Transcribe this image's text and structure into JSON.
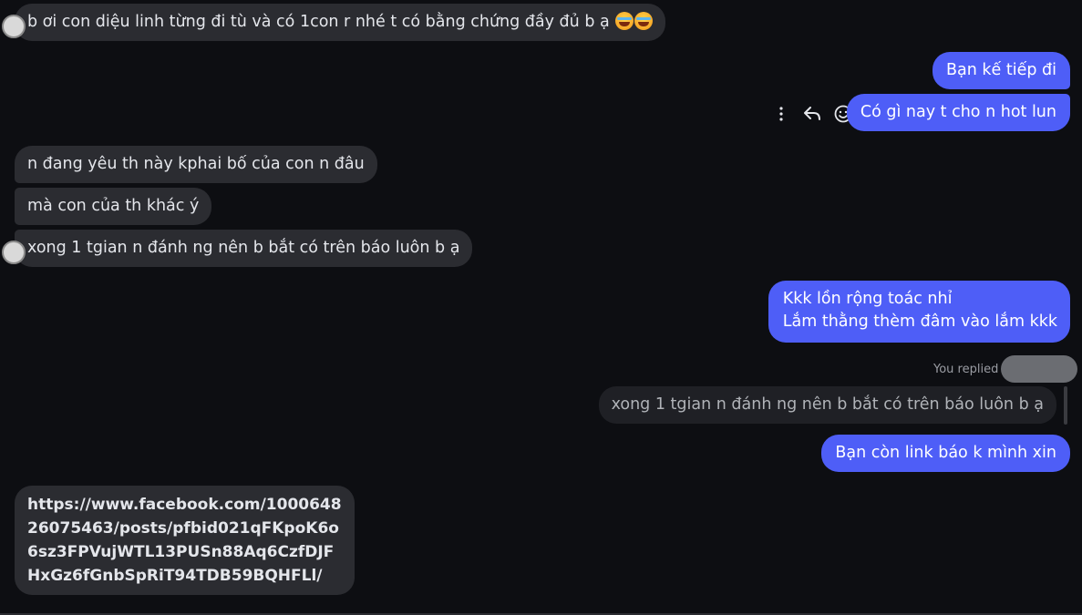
{
  "messages": {
    "in_1": {
      "text": "b ơi con diệu linh từng đi tù và có 1con r nhé t có bằng chứng đầy đủ b ạ",
      "emoji": "😂😂"
    },
    "out_1": "Bạn kế tiếp đi",
    "out_2": "Có gì nay t cho n hot lun",
    "in_2": "n đang yêu th này kphai bố của con n đâu",
    "in_3": "mà con của th khác ý",
    "in_4": "xong 1 tgian n đánh ng nên b bắt có trên báo luôn b ạ",
    "out_3_line1": "Kkk lồn rộng toác nhỉ",
    "out_3_line2": "Lắm thằng thèm đâm vào lắm kkk",
    "reply_label": "You replied",
    "quoted_text": "xong 1 tgian n đánh ng nên b bắt có trên báo luôn b ạ",
    "out_4": "Bạn còn link báo k mình xin",
    "link": "https://www.facebook.com/100064826075463/posts/pfbid021qFKpoK6o6sz3FPVujWTL13PUSn88Aq6CzfDJFHxGz6fGnbSpRiT94TDB59BQHFLl/"
  },
  "actions": {
    "more_icon": "more-vertical-icon",
    "reply_icon": "reply-arrow-icon",
    "react_icon": "smiley-icon"
  },
  "colors": {
    "background": "#0d0e12",
    "incoming_bubble": "#2b2c31",
    "outgoing_bubble": "#4e5ef7",
    "text": "#e4e6eb"
  }
}
